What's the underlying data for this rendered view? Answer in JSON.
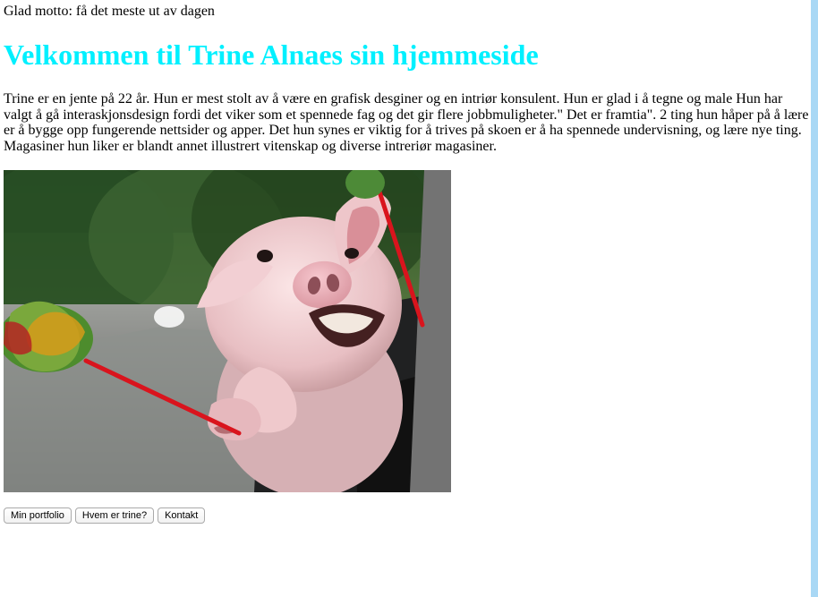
{
  "motto": "Glad motto: få det meste ut av dagen",
  "heading": {
    "text": "Velkommen til Trine Alnaes sin hjemmeside",
    "color": "#00f0ff"
  },
  "intro": "Trine er en jente på 22 år. Hun er mest stolt av å være en grafisk desginer og en intriør konsulent. Hun er glad i å tegne og male Hun har valgt å gå interaskjonsdesign fordi det viker som et spennede fag og det gir flere jobbmuligheter.\" Det er framtia\". 2 ting hun håper på å lære er å bygge opp fungerende nettsider og apper. Det hun synes er viktig for å trives på skoen er å ha spennede undervisning, og lære nye ting. Magasiner hun liker er blandt annet illustrert vitenskap og diverse intreriør magasiner.",
  "image": {
    "name": "pig-in-car-window-image"
  },
  "buttons": [
    {
      "label": "Min portfolio"
    },
    {
      "label": "Hvem er trine?"
    },
    {
      "label": "Kontakt"
    }
  ],
  "colors": {
    "scrollbar_edge": "#a9d8f5"
  }
}
